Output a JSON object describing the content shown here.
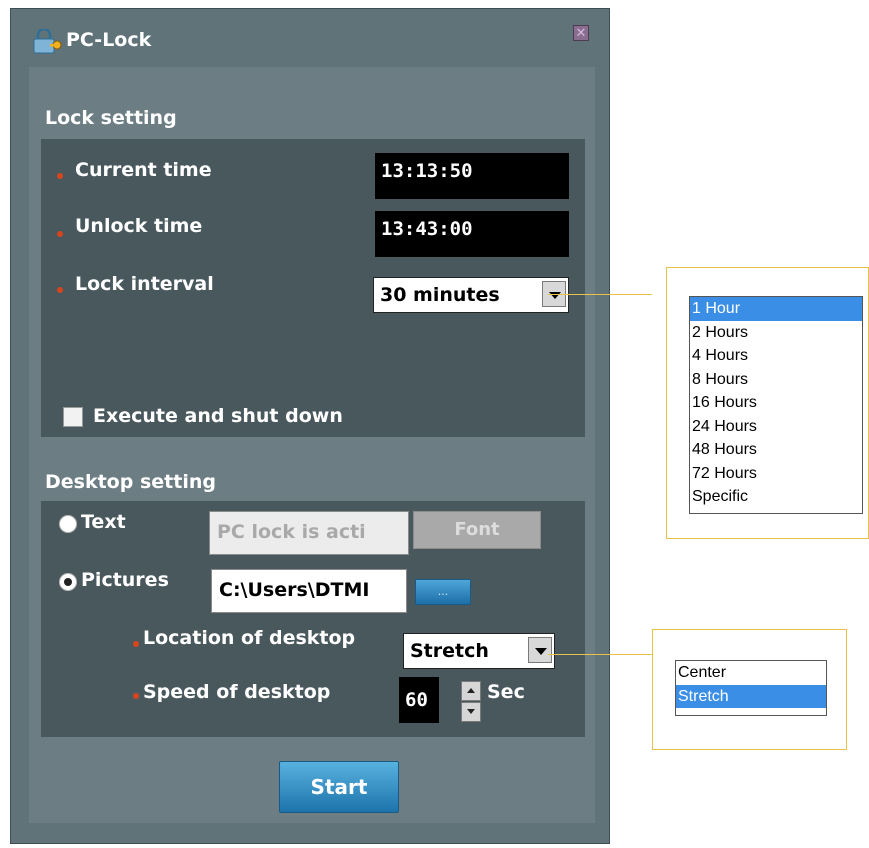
{
  "window": {
    "title": "PC-Lock"
  },
  "lock_setting": {
    "title": "Lock setting",
    "current_time_label": "Current time",
    "current_time_value": "13:13:50",
    "unlock_time_label": "Unlock time",
    "unlock_time_value": "13:43:00",
    "lock_interval_label": "Lock interval",
    "lock_interval_value": "30 minutes",
    "execute_shutdown_label": "Execute and shut down"
  },
  "desktop_setting": {
    "title": "Desktop setting",
    "text_radio_label": "Text",
    "text_value": "PC lock is acti",
    "font_button": "Font",
    "pictures_radio_label": "Pictures",
    "pictures_path": "C:\\Users\\DTMI",
    "browse_button": "...",
    "location_label": "Location of desktop",
    "location_value": "Stretch",
    "speed_label": "Speed of desktop",
    "speed_value": "60",
    "speed_unit": "Sec"
  },
  "start_button": "Start",
  "interval_dropdown": {
    "options": [
      "1 Hour",
      "2 Hours",
      "4 Hours",
      "8 Hours",
      "16 Hours",
      "24 Hours",
      "48 Hours",
      "72 Hours",
      "Specific"
    ],
    "selected": "1 Hour"
  },
  "location_dropdown": {
    "options": [
      "Center",
      "Stretch"
    ],
    "selected": "Stretch"
  }
}
